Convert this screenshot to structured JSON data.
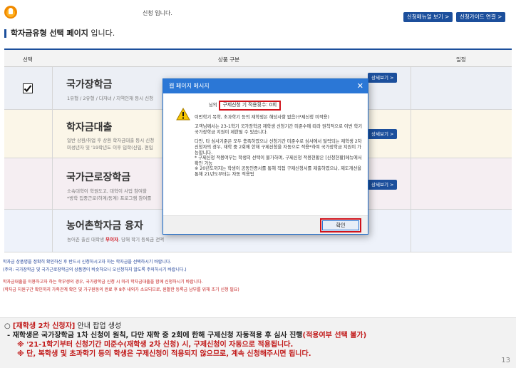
{
  "header": {
    "notice": "신청 입니다.",
    "manual_button": "신청매뉴얼 보기 >",
    "guide_button": "신청가이드 연결 >"
  },
  "page_title": {
    "strong": "학자금유형 선택 페이지",
    "rest": " 입니다."
  },
  "table": {
    "col_select": "선택",
    "col_product": "상품 구분",
    "col_schedule": "일정",
    "rows": [
      {
        "name": "국가장학금",
        "desc1": "1유형 / 2유형 / 다자녀 / 지역인재 등시 신청",
        "desc2": "",
        "detail": "상세보기 >",
        "checked": true
      },
      {
        "name": "학자금대출",
        "desc1": "일반 상환/취업 후 상환 학자금대출 등시 신청",
        "desc2": "미성년자 및 '19학년도 이후 입학(신입, 편입",
        "detail": "상세보기 >",
        "checked": false
      },
      {
        "name": "국가근로장학금",
        "desc1": "소속대학이 학원도고, 대학이 사업 참여할",
        "desc2": "*방학 집중근로(하계/동계) 프로그램 참여를",
        "detail": "상세보기 >",
        "checked": false
      },
      {
        "name": "농어촌학자금 융자",
        "desc1_pre": "농어촌 출신 대학생 ",
        "desc1_red": "무이자",
        "desc1_post": ", 당해 학기 등록금 전액",
        "detail": "",
        "checked": false
      }
    ]
  },
  "notes": {
    "blue1": "학자금 상품명을 정확히 확인하신 후 반드시 신청하시고자 하는 학자금을 선택하시기 바랍니다.",
    "blue2": "(주의: 국가장학금 및 국가근로장학금의 상품명이 비슷하오니 오신청하지 않도록 주의하시기 바랍니다.)",
    "red1": "학자금대출을 이용하고자 하는 학부생의 경우, 국가장학금 신청 시 미리 학자금대출을 함께 신청하시기 바랍니다.",
    "red2": "(학자금 지원구간 확인까지 가족관계 확인 및 가구원동의 완료 후 8주 내외가 소요되므로, 원활한 등록금 납부를 위해 조기 신청 필요)"
  },
  "dialog": {
    "title": "웹 페이지 메시지",
    "close": "✕",
    "line1_prefix": "님의",
    "line1_highlight": "구제신청 기 적용횟수: 0회",
    "para1": "이번학기 복학, 초과학기 등의 재학생은 해당사항 없음(구제신청 미적용)",
    "para2": "고객님께서는 23-1학기 국가장학금 재학생 신청기간 미준수에 따라 원칙적으로 이번 학기 국가장학금 지원이 제한될 수 있습니다.",
    "para3": "다만, 타 심사기준은 모두 충족하였으나 신청기간 미준수로 심사에서 탈락되는 재학생 2차 신청자의 경우, 재학 중 2회에 한해 구제신청을 자동으로 적용*하여 국가장학금 지원이 가능합니다.",
    "para4": "* 구제신청 적용여부는 학생의 선택이 불가하며, 구제신청 적용현황은 [신청현황]메뉴에서 확인 가능",
    "para5": "※ 20년도까지는 학생이 공동인증서를 통해 직접 구제신청서를 제출하였으나, 제도개선을 통해 21년도부터는 자동 적용됨",
    "ok": "확인"
  },
  "bottom": {
    "l1_prefix": "○ ",
    "l1_red": "[재학생 2차 신청자]",
    "l1_rest": " 안내 팝업 생성",
    "l2_text": "- 재학생은 국가장학금 1차 신청이 원칙, 다만 재학 중 2회에 한해 구제신청 자동적용 후 심사 진행",
    "l2_red": "(적용여부 선택 불가)",
    "l3": "※ '21-1학기부터 신청기간 미준수(재학생 2차 신청) 시, 구제신청이 자동으로 적용됩니다.",
    "l4": "※ 단, 복학생 및 초과학기 등의 학생은 구제신청이 적용되지 않으므로, 계속 신청해주시면 됩니다.",
    "page": "13"
  },
  "colors": {
    "brand_blue": "#1c4f9c",
    "dialog_blue": "#2b77d6",
    "highlight_red": "#d0121b"
  },
  "icons": [
    "logo-icon",
    "warning-icon",
    "checkbox-checked-icon",
    "close-icon"
  ]
}
